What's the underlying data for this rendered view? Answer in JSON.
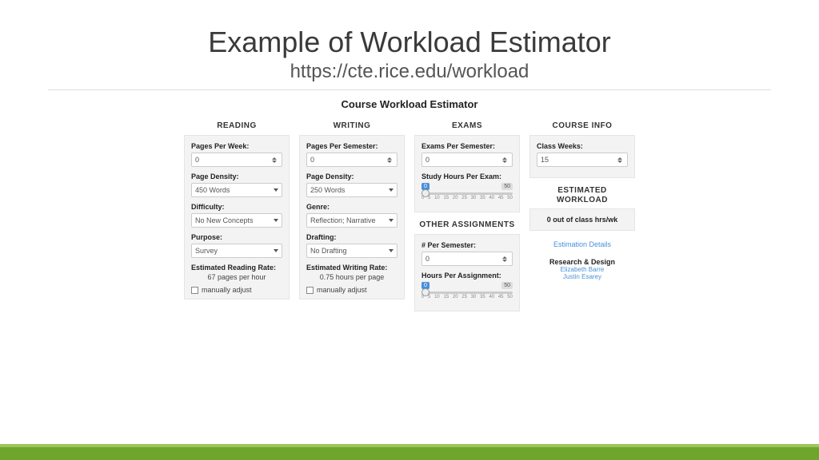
{
  "slide": {
    "title": "Example of Workload Estimator",
    "subtitle": "https://cte.rice.edu/workload"
  },
  "app": {
    "title": "Course Workload Estimator"
  },
  "reading": {
    "heading": "READING",
    "pages_label": "Pages Per Week:",
    "pages_value": "0",
    "density_label": "Page Density:",
    "density_value": "450 Words",
    "difficulty_label": "Difficulty:",
    "difficulty_value": "No New Concepts",
    "purpose_label": "Purpose:",
    "purpose_value": "Survey",
    "rate_label": "Estimated Reading Rate:",
    "rate_value": "67 pages per hour",
    "adjust": "manually adjust"
  },
  "writing": {
    "heading": "WRITING",
    "pages_label": "Pages Per Semester:",
    "pages_value": "0",
    "density_label": "Page Density:",
    "density_value": "250 Words",
    "genre_label": "Genre:",
    "genre_value": "Reflection; Narrative",
    "drafting_label": "Drafting:",
    "drafting_value": "No Drafting",
    "rate_label": "Estimated Writing Rate:",
    "rate_value": "0.75 hours per page",
    "adjust": "manually adjust"
  },
  "exams": {
    "heading": "EXAMS",
    "per_sem_label": "Exams Per Semester:",
    "per_sem_value": "0",
    "study_label": "Study Hours Per Exam:",
    "study_min": "0",
    "study_max": "50",
    "ticks": [
      "0",
      "5",
      "10",
      "15",
      "20",
      "25",
      "30",
      "35",
      "40",
      "45",
      "50"
    ]
  },
  "other": {
    "heading": "OTHER ASSIGNMENTS",
    "per_sem_label": "# Per Semester:",
    "per_sem_value": "0",
    "hours_label": "Hours Per Assignment:",
    "hours_min": "0",
    "hours_max": "50",
    "ticks": [
      "0",
      "5",
      "10",
      "15",
      "20",
      "25",
      "30",
      "35",
      "40",
      "45",
      "50"
    ]
  },
  "course": {
    "heading": "COURSE INFO",
    "weeks_label": "Class Weeks:",
    "weeks_value": "15"
  },
  "estimate": {
    "heading1": "ESTIMATED",
    "heading2": "WORKLOAD",
    "value": "0 out of class hrs/wk",
    "details_link": "Estimation Details"
  },
  "credits": {
    "heading": "Research & Design",
    "name1": "Elizabeth Barre",
    "name2": "Justin Esarey"
  }
}
